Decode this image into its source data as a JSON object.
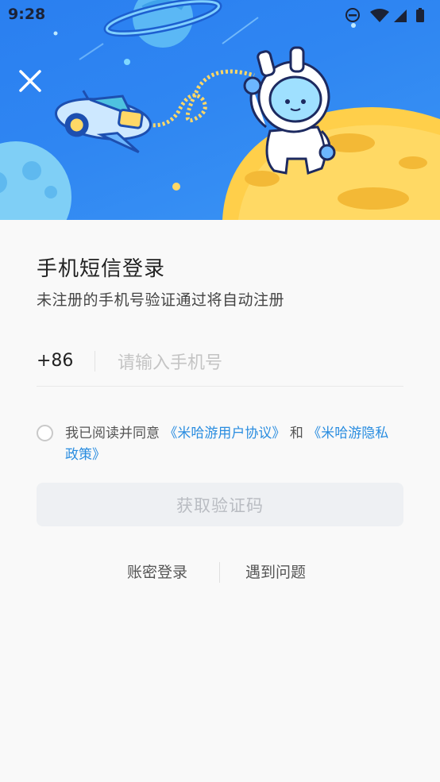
{
  "status_bar": {
    "time": "9:28",
    "icons": [
      "do-not-disturb-icon",
      "wifi-icon",
      "cell-signal-icon",
      "battery-icon"
    ]
  },
  "header": {
    "close_icon": "close-icon"
  },
  "login": {
    "title": "手机短信登录",
    "subtitle": "未注册的手机号验证通过将自动注册",
    "country_code": "+86",
    "phone_placeholder": "请输入手机号",
    "phone_value": "",
    "agreement": {
      "prefix": "我已阅读并同意",
      "user_agreement": "《米哈游用户协议》",
      "conjunction": "和",
      "privacy_policy": "《米哈游隐私政策》",
      "checked": false
    },
    "get_code_button": "获取验证码",
    "password_login_link": "账密登录",
    "help_link": "遇到问题"
  },
  "colors": {
    "banner": "#2f86f2",
    "link": "#2a8de0",
    "button_bg": "#eef0f3",
    "button_text": "#b9bcc2"
  }
}
